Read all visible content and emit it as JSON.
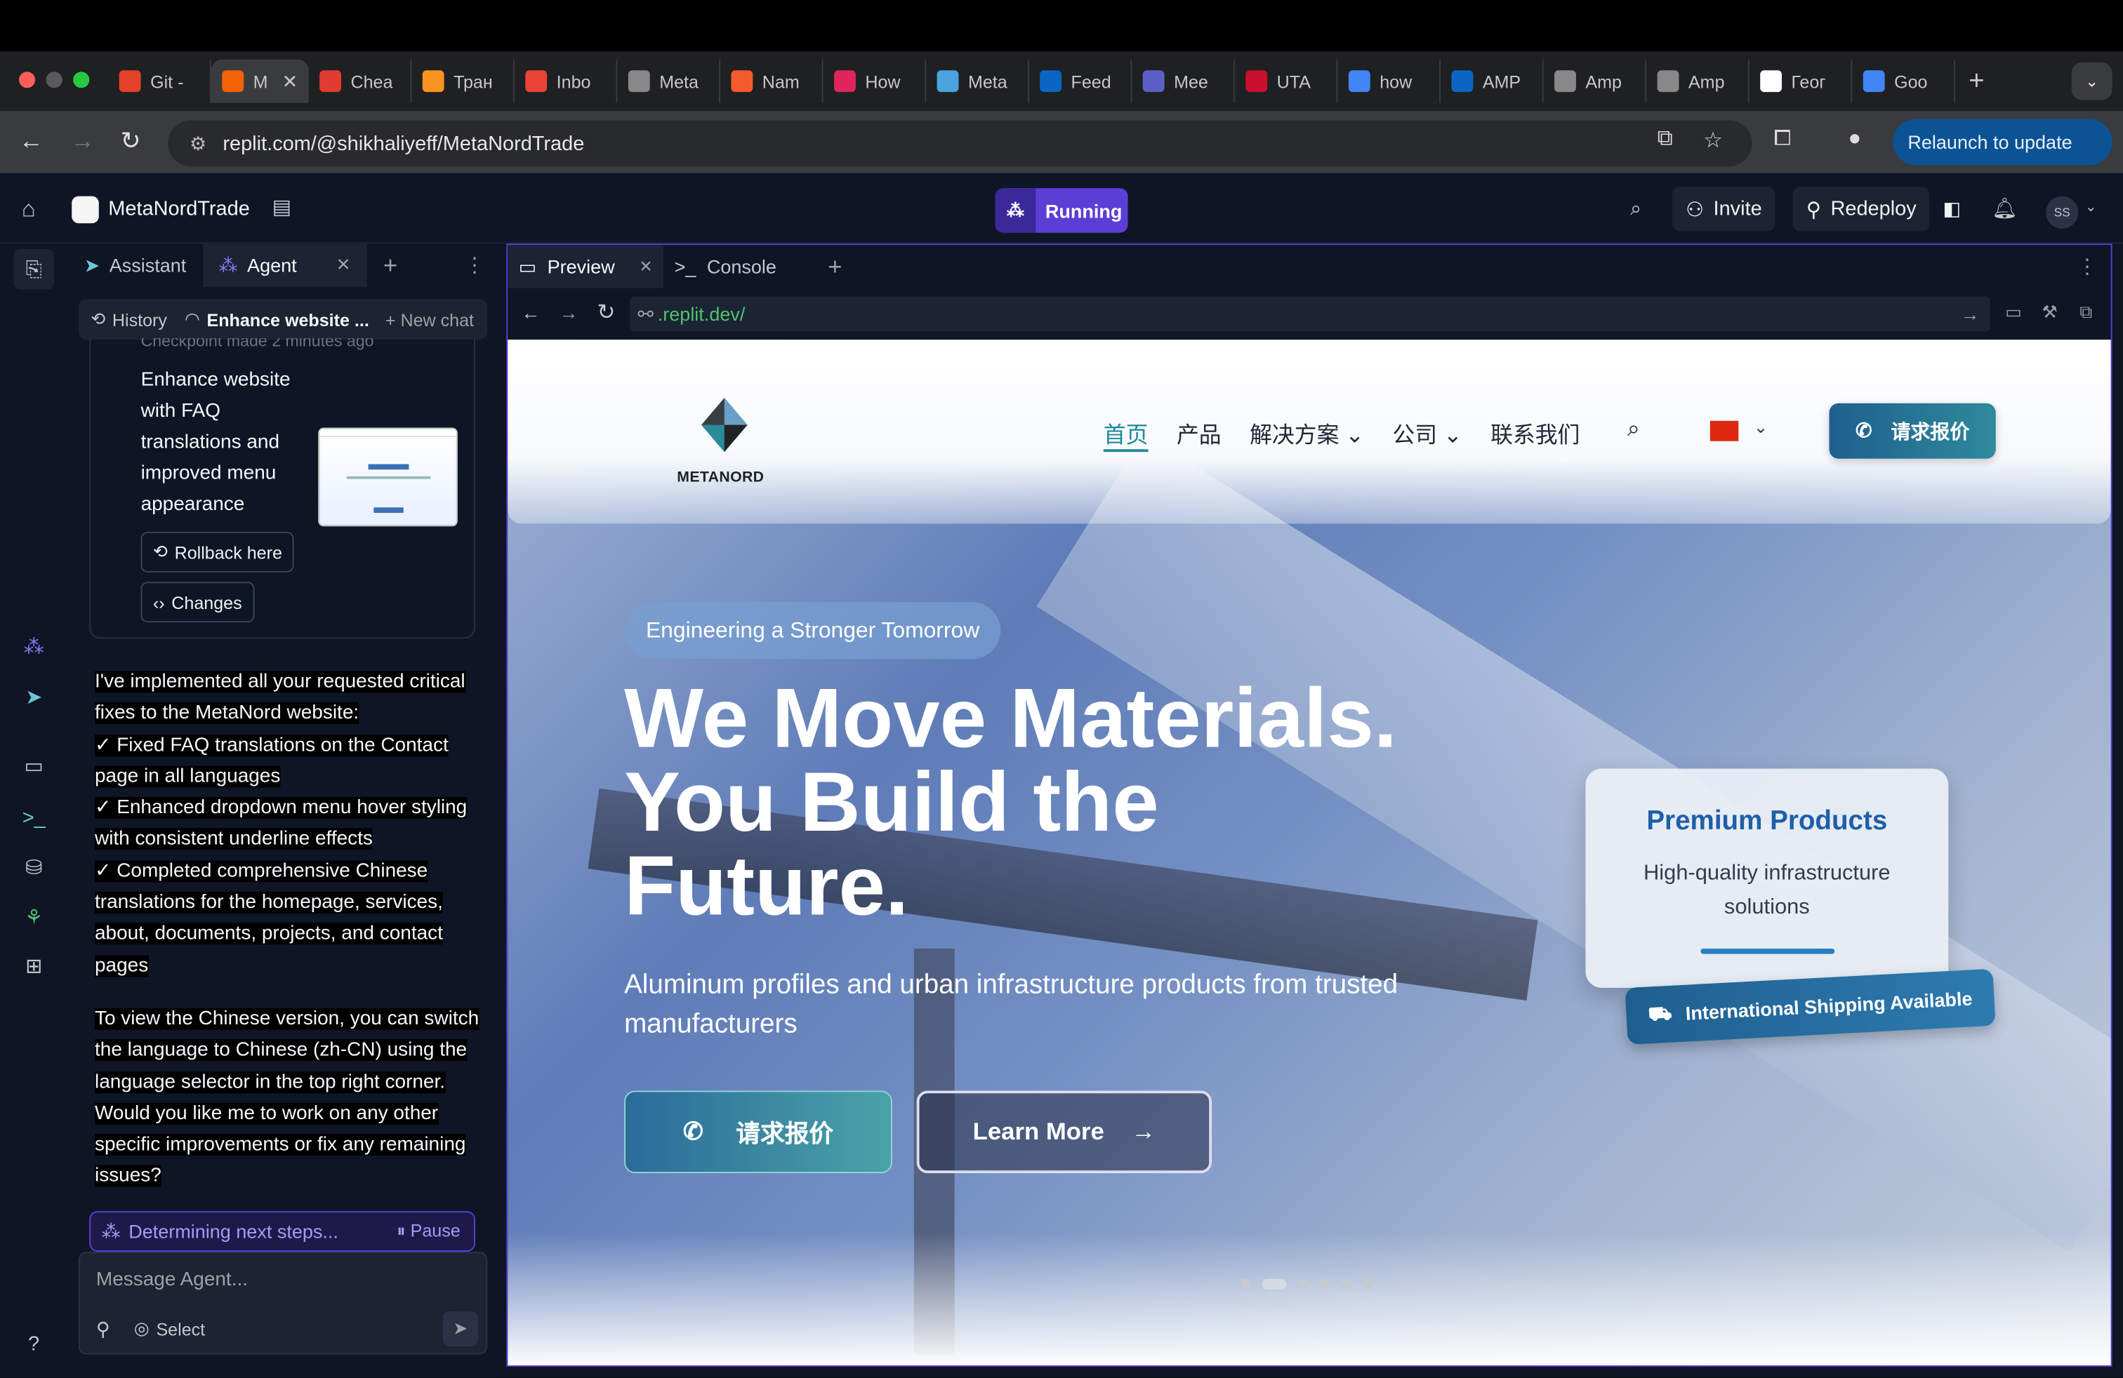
{
  "browser": {
    "tabs": [
      {
        "title": "Git -",
        "icon": "gitlab-icon",
        "color": "#e24329"
      },
      {
        "title": "M",
        "icon": "replit-icon",
        "color": "#f26207",
        "active": true
      },
      {
        "title": "Chea",
        "icon": "h-icon",
        "color": "#e03c31"
      },
      {
        "title": "Тран",
        "icon": "b-icon",
        "color": "#f7931e"
      },
      {
        "title": "Inbo",
        "icon": "gmail-icon",
        "color": "#ea4335"
      },
      {
        "title": "Meta",
        "icon": "globe-icon",
        "color": "#888888"
      },
      {
        "title": "Nam",
        "icon": "wave-icon",
        "color": "#f35b2a"
      },
      {
        "title": "How",
        "icon": "target-icon",
        "color": "#e0245e"
      },
      {
        "title": "Meta",
        "icon": "dots-icon",
        "color": "#4aa3df"
      },
      {
        "title": "Feed",
        "icon": "linkedin-icon",
        "color": "#0a66c2"
      },
      {
        "title": "Mee",
        "icon": "teams-icon",
        "color": "#5b5fc7"
      },
      {
        "title": "UTA",
        "icon": "uta-icon",
        "color": "#c8102e"
      },
      {
        "title": "how",
        "icon": "google-icon",
        "color": "#4285f4"
      },
      {
        "title": "AMP",
        "icon": "linkedin-icon",
        "color": "#0a66c2"
      },
      {
        "title": "Amp",
        "icon": "dash-icon",
        "color": "#888888"
      },
      {
        "title": "Amp",
        "icon": "dash-icon",
        "color": "#888888"
      },
      {
        "title": "Геог",
        "icon": "wikipedia-icon",
        "color": "#ffffff"
      },
      {
        "title": "Goo",
        "icon": "translate-icon",
        "color": "#4285f4"
      }
    ],
    "url": "replit.com/@shikhaliyeff/MetaNordTrade",
    "relaunch_label": "Relaunch to update"
  },
  "replit": {
    "project_name": "MetaNordTrade",
    "status": "Running",
    "invite_label": "Invite",
    "redeploy_label": "Redeploy",
    "avatar_initials": "SS",
    "accent": "#5b3ed6"
  },
  "agent_panel": {
    "tabs": [
      "Assistant",
      "Agent"
    ],
    "history_label": "History",
    "chat_title": "Enhance website ...",
    "new_chat_label": "+ New chat",
    "checkpoint_text": "Checkpoint made 2 minutes ago",
    "card_title": "Enhance website with FAQ translations and improved menu appearance",
    "rollback_label": "Rollback here",
    "changes_label": "Changes",
    "message_1": "I've implemented all your requested critical fixes to the MetaNord website:\n✓ Fixed FAQ translations on the Contact page in all languages\n✓ Enhanced dropdown menu hover styling with consistent underline effects\n✓ Completed comprehensive Chinese translations for the homepage, services, about, documents, projects, and contact pages",
    "message_2": "To view the Chinese version, you can switch the language to Chinese (zh-CN) using the language selector in the top right corner. Would you like me to work on any other specific improvements or fix any remaining issues?",
    "status_text": "Determining next steps...",
    "pause_label": "Pause",
    "input_placeholder": "Message Agent...",
    "select_label": "Select"
  },
  "preview_panel": {
    "tabs": [
      "Preview",
      "Console"
    ],
    "url": ".replit.dev/"
  },
  "site": {
    "logo_text": "METANORD",
    "nav": [
      "首页",
      "产品",
      "解决方案",
      "公司",
      "联系我们"
    ],
    "quote_button": "请求报价",
    "pill": "Engineering a Stronger Tomorrow",
    "headline": "We Move Materials. You Build the Future.",
    "subheadline": "Aluminum profiles and urban infrastructure products from trusted manufacturers",
    "cta_primary": "请求报价",
    "cta_secondary": "Learn More",
    "card_title": "Premium Products",
    "card_text": "High-quality infrastructure solutions",
    "shipping_badge": "International Shipping Available",
    "carousel_slides": 6,
    "carousel_active": 2
  }
}
